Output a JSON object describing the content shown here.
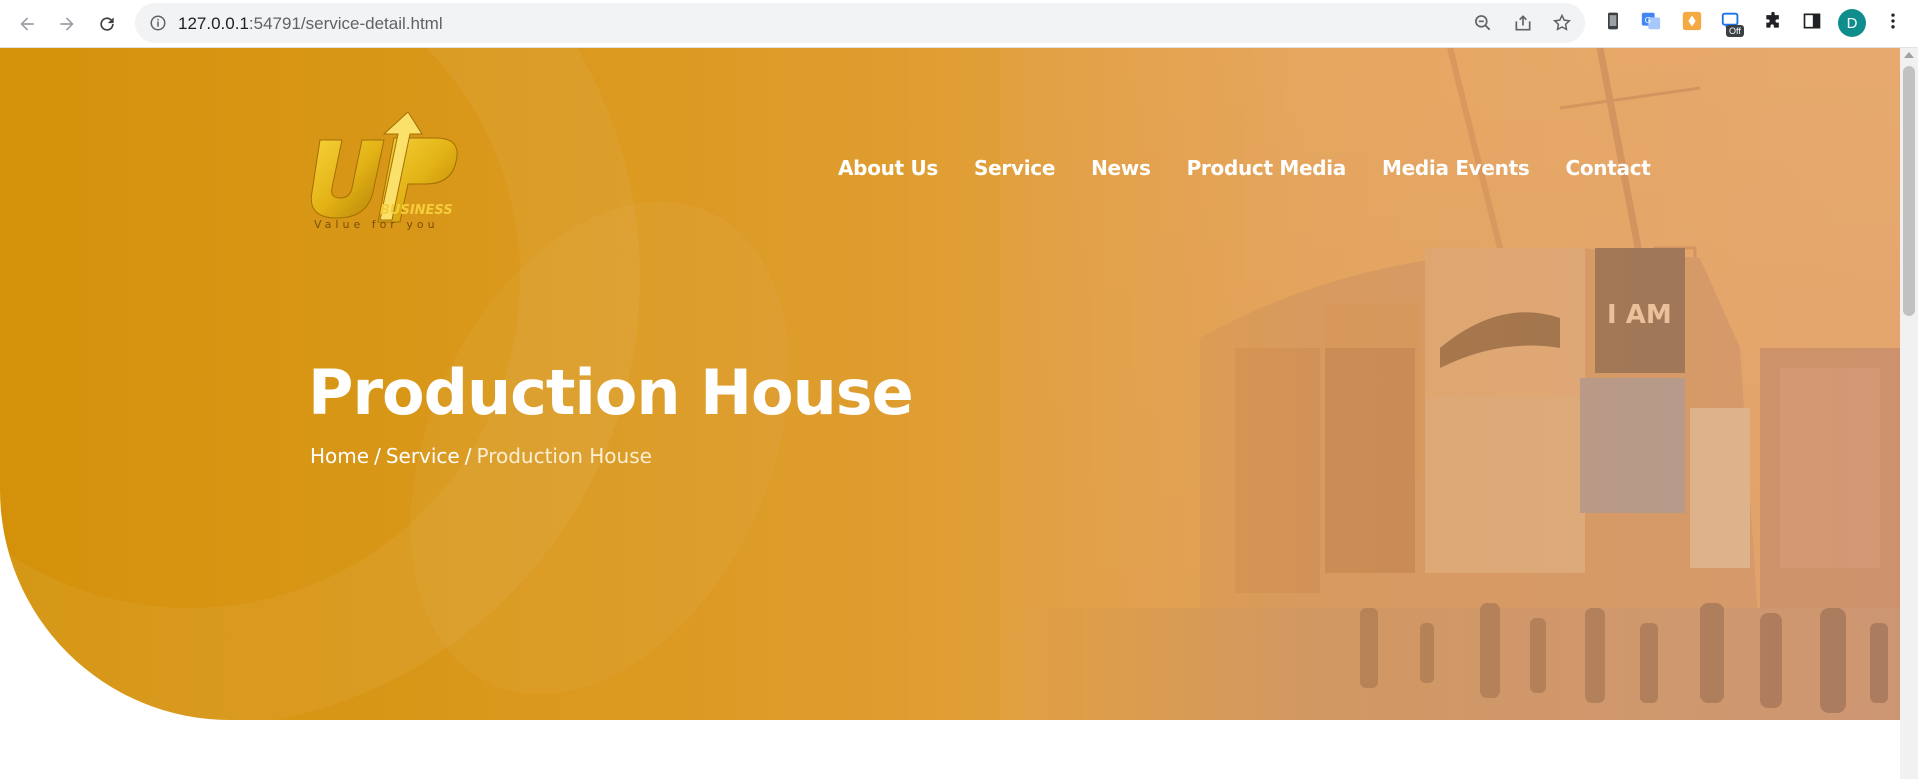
{
  "browser": {
    "url_host": "127.0.0.1",
    "url_rest": ":54791/service-detail.html",
    "avatar_letter": "D",
    "ext_badge": "Off"
  },
  "brand": {
    "logo_text": "UP",
    "logo_sub": "BUSINESS",
    "tagline": "Value for you",
    "accent": "#d4920a"
  },
  "nav": {
    "items": [
      {
        "label": "About Us"
      },
      {
        "label": "Service"
      },
      {
        "label": "News"
      },
      {
        "label": "Product Media"
      },
      {
        "label": "Media Events"
      },
      {
        "label": "Contact"
      }
    ]
  },
  "hero": {
    "title": "Production House",
    "breadcrumb": {
      "home": "Home",
      "sep1": "/",
      "service": "Service",
      "sep2": "/",
      "current": "Production House"
    }
  }
}
